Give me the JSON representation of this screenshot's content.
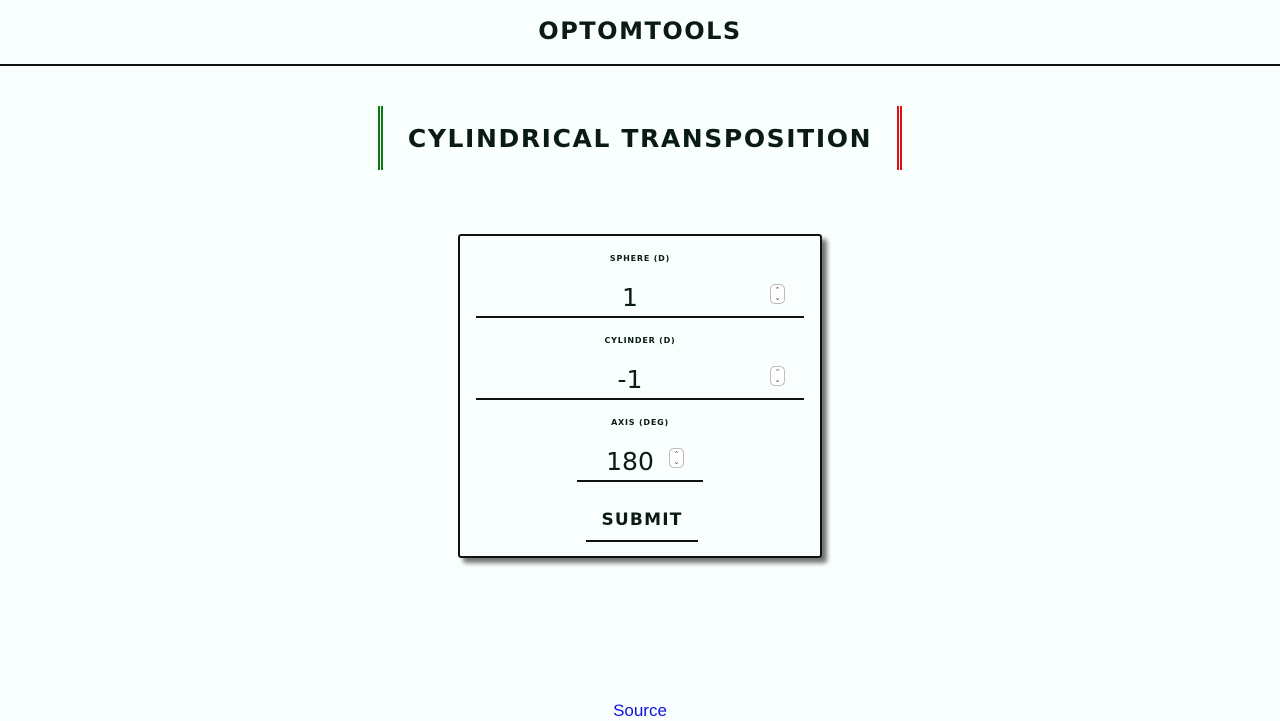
{
  "header": {
    "brand": "OPTOMTOOLS"
  },
  "page": {
    "title": "CYLINDRICAL TRANSPOSITION",
    "accent_left": "#0b7a12",
    "accent_right": "#e01010"
  },
  "form": {
    "sphere": {
      "label": "SPHERE (D)",
      "value": "1"
    },
    "cylinder": {
      "label": "CYLINDER (D)",
      "value": "-1"
    },
    "axis": {
      "label": "AXIS (DEG)",
      "value": "180"
    },
    "submit_label": "SUBMIT",
    "spinner_up": "⌃",
    "spinner_down": "⌄"
  },
  "footer": {
    "source_label": "Source"
  }
}
